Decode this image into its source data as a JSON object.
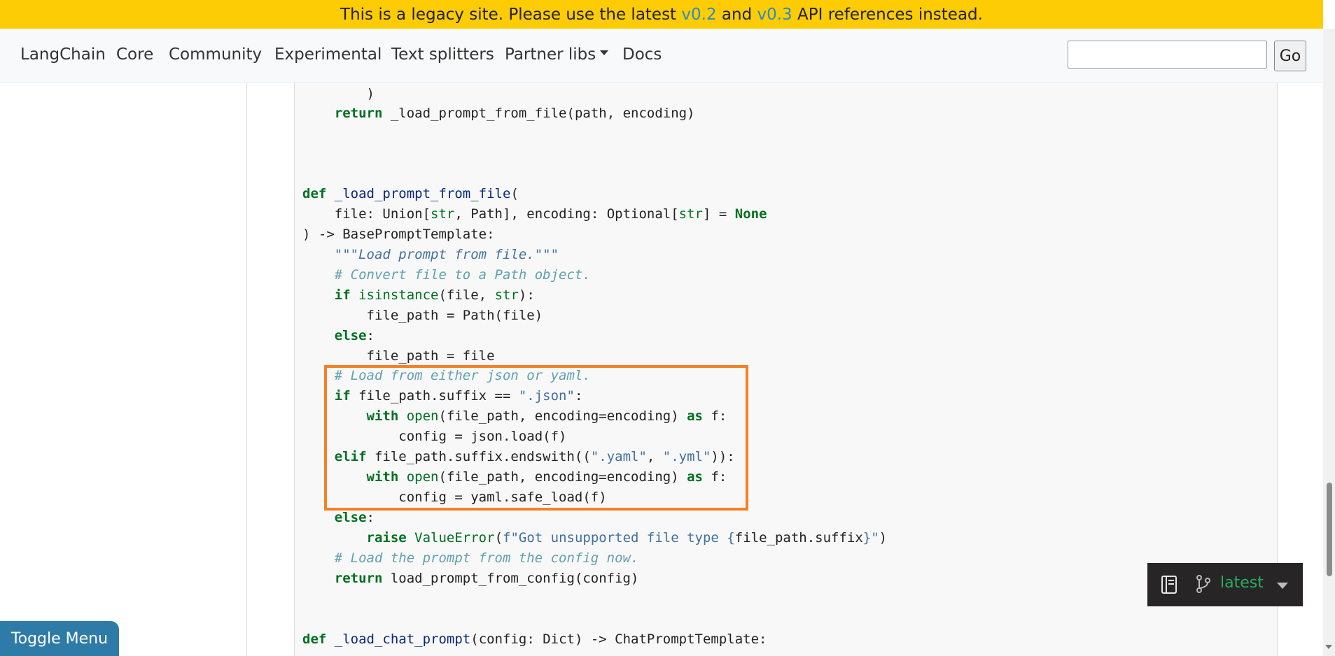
{
  "banner": {
    "text_before": "This is a legacy site. Please use the latest ",
    "link1": "v0.2",
    "text_mid": " and ",
    "link2": "v0.3",
    "text_after": " API references instead."
  },
  "nav": {
    "items": [
      "LangChain",
      "Core",
      "Community",
      "Experimental",
      "Text splitters",
      "Partner libs",
      "Docs"
    ],
    "go_label": "Go",
    "search_value": ""
  },
  "code": {
    "lines": [
      "        )",
      "    return _load_prompt_from_file(path, encoding)",
      "def _load_prompt_from_file(",
      "    file: Union[str, Path], encoding: Optional[str] = None",
      ") -> BasePromptTemplate:",
      "    \"\"\"Load prompt from file.\"\"\"",
      "    # Convert file to a Path object.",
      "    if isinstance(file, str):",
      "        file_path = Path(file)",
      "    else:",
      "        file_path = file",
      "    # Load from either json or yaml.",
      "    if file_path.suffix == \".json\":",
      "        with open(file_path, encoding=encoding) as f:",
      "            config = json.load(f)",
      "    elif file_path.suffix.endswith((\".yaml\", \".yml\")):",
      "        with open(file_path, encoding=encoding) as f:",
      "            config = yaml.safe_load(f)",
      "    else:",
      "        raise ValueError(f\"Got unsupported file type {file_path.suffix}\")",
      "    # Load the prompt from the config now.",
      "    return load_prompt_from_config(config)",
      "def _load_chat_prompt(config: Dict) -> ChatPromptTemplate:"
    ]
  },
  "version_widget": {
    "label": "latest"
  },
  "toggle_menu": {
    "label": "Toggle Menu"
  },
  "colors": {
    "banner_bg": "#fdcc05",
    "link": "#2b8cbe",
    "highlight_box": "#f58025",
    "keyword": "#007020",
    "string": "#4070a0",
    "comment": "#60a0b0",
    "toggle_bg": "#2f7ba8",
    "version_text": "#27ae60"
  }
}
